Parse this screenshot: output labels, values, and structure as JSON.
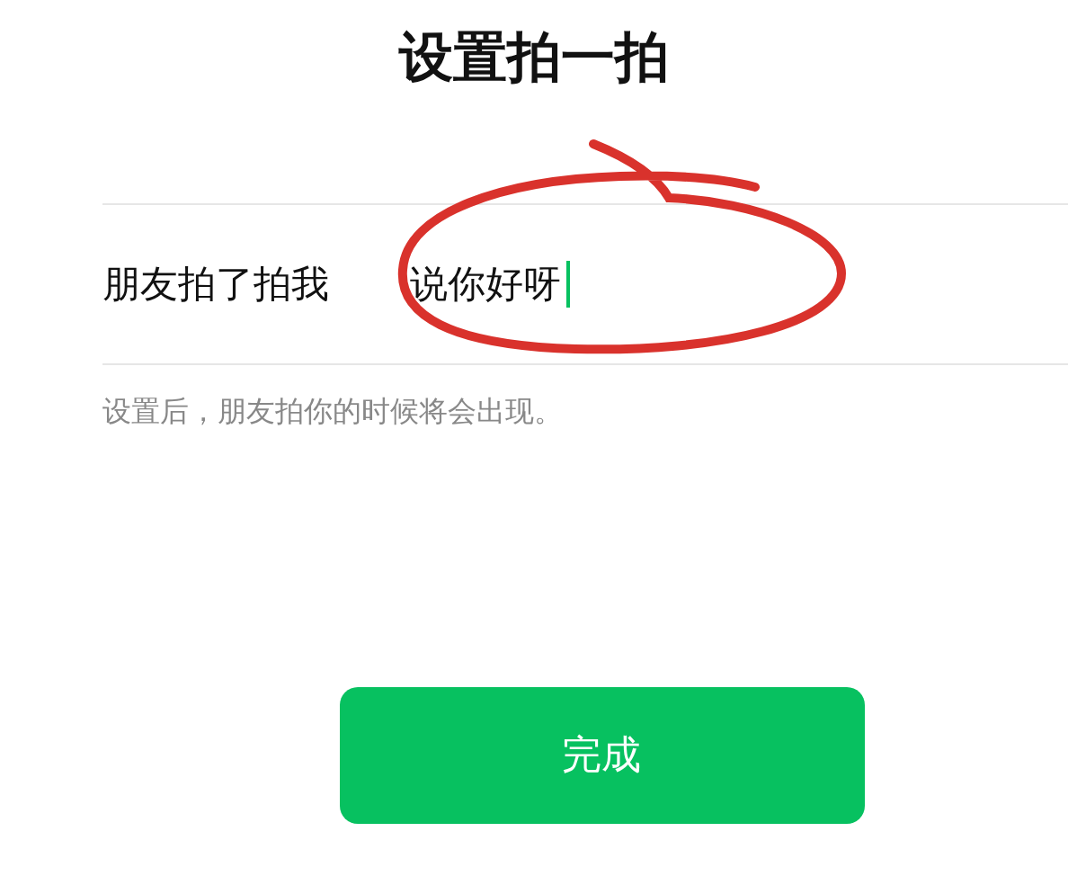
{
  "title": "设置拍一拍",
  "row": {
    "label": "朋友拍了拍我",
    "value": "说你好呀"
  },
  "hint": "设置后，朋友拍你的时候将会出现。",
  "buttons": [
    "完成"
  ]
}
